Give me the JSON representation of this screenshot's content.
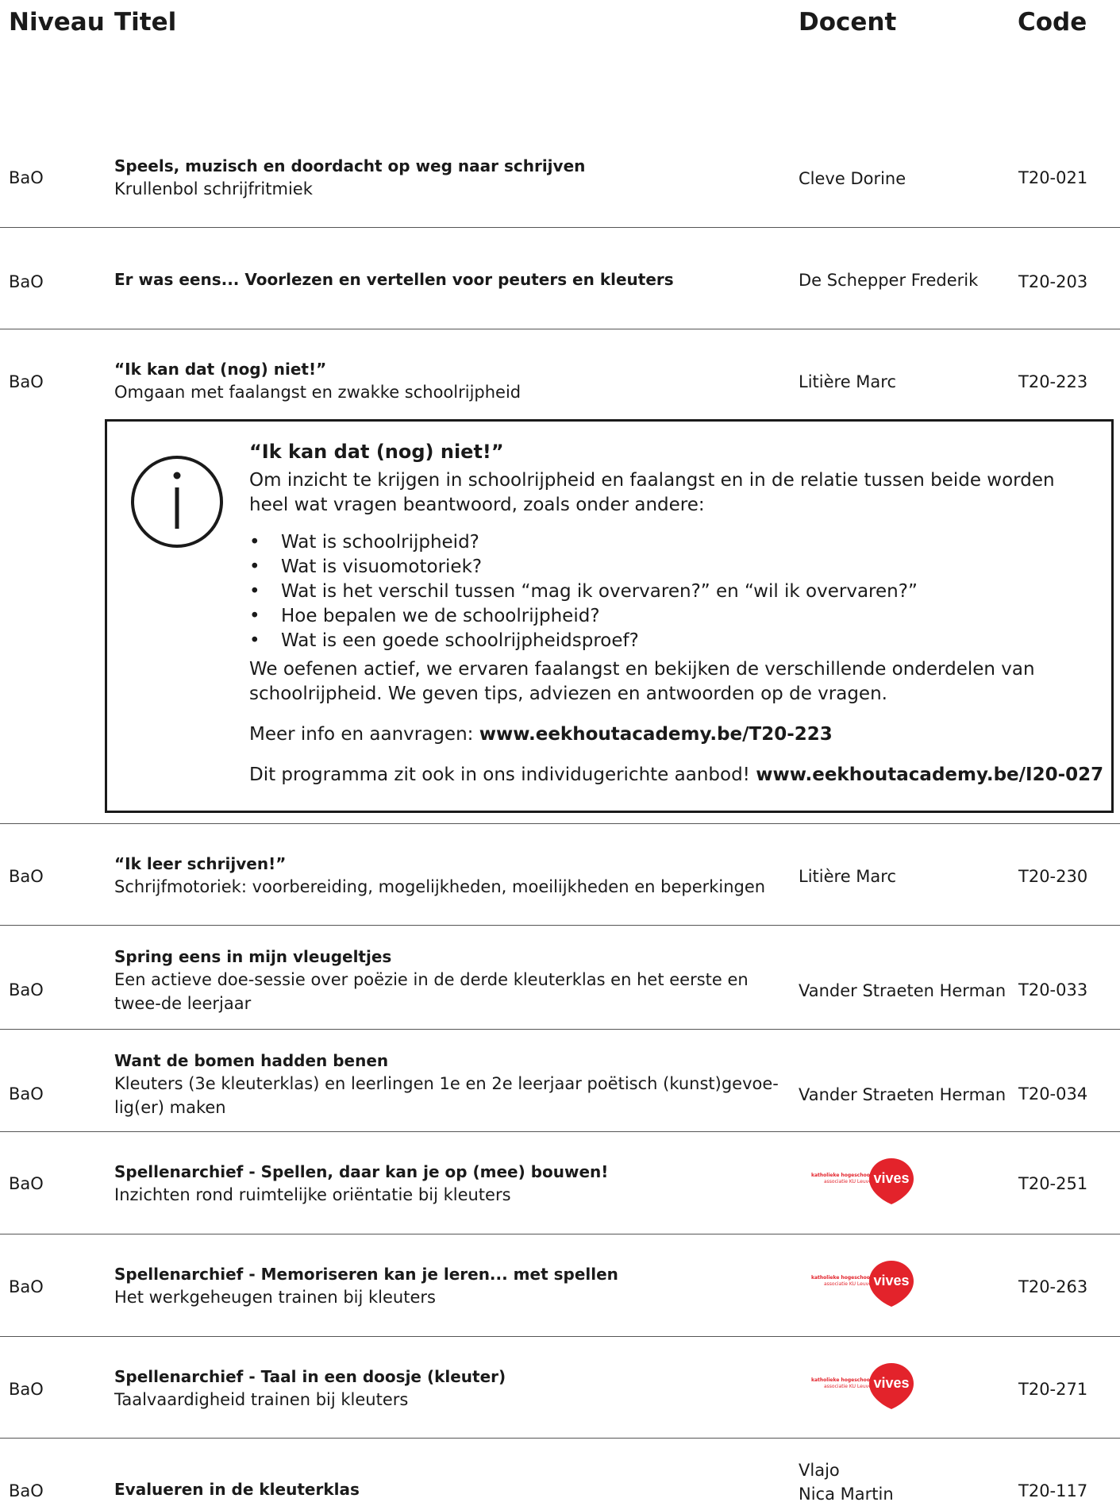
{
  "header": {
    "niveau": "Niveau",
    "titel": "Titel",
    "docent": "Docent",
    "code": "Code"
  },
  "rows": [
    {
      "niveau": "BaO",
      "title": "Speels, muzisch en doordacht op weg naar schrijven",
      "subtitle": "Krullenbol schrijfritmiek",
      "docent": "Cleve Dorine",
      "code": "T20-021"
    },
    {
      "niveau": "BaO",
      "title": "Er was eens... Voorlezen en vertellen voor peuters en kleuters",
      "subtitle": "",
      "docent": "De Schepper Frederik",
      "code": "T20-203"
    },
    {
      "niveau": "BaO",
      "title": "“Ik kan dat (nog) niet!”",
      "subtitle": "Omgaan met faalangst en zwakke schoolrijpheid",
      "docent": "Litière Marc",
      "code": "T20-223"
    },
    {
      "niveau": "BaO",
      "title": "“Ik leer schrijven!”",
      "subtitle": "Schrijfmotoriek: voorbereiding, mogelijkheden, moeilijkheden en beperkingen",
      "docent": "Litière Marc",
      "code": "T20-230"
    },
    {
      "niveau": "BaO",
      "title": "Spring eens in mijn vleugeltjes",
      "subtitle": "Een actieve doe-sessie over poëzie in de derde kleuterklas en het eerste en twee-de leerjaar",
      "docent": "Vander Straeten Herman",
      "code": "T20-033"
    },
    {
      "niveau": "BaO",
      "title": "Want de bomen hadden benen",
      "subtitle": "Kleuters (3e kleuterklas) en leerlingen 1e en 2e leerjaar poëtisch (kunst)gevoe-lig(er) maken",
      "docent": "Vander Straeten Herman",
      "code": "T20-034"
    },
    {
      "niveau": "BaO",
      "title": "Spellenarchief - Spellen, daar kan je op (mee) bouwen!",
      "subtitle": "Inzichten rond ruimtelijke oriëntatie bij kleuters",
      "docent": "",
      "code": "T20-251"
    },
    {
      "niveau": "BaO",
      "title": "Spellenarchief - Memoriseren kan je leren... met spellen",
      "subtitle": "Het werkgeheugen trainen bij kleuters",
      "docent": "",
      "code": "T20-263"
    },
    {
      "niveau": "BaO",
      "title": "Spellenarchief - Taal in een doosje (kleuter)",
      "subtitle": "Taalvaardigheid trainen bij kleuters",
      "docent": "",
      "code": "T20-271"
    },
    {
      "niveau": "BaO",
      "title": "Evalueren in de kleuterklas",
      "subtitle": "",
      "docent": "Vlajo",
      "docent2": "Nica Martin",
      "code": "T20-117"
    }
  ],
  "logo": {
    "word": "vives",
    "line1": "katholieke hogeschool",
    "line2": "associatie KU Leuven"
  },
  "infobox": {
    "title": "“Ik kan dat (nog) niet!”",
    "intro_line1": "Om inzicht te krijgen in schoolrijpheid en faalangst en in de relatie tussen beide worden",
    "intro_line2": "heel wat vragen beantwoord, zoals onder andere:",
    "bullets": [
      "Wat is schoolrijpheid?",
      "Wat is visuomotoriek?",
      "Wat is het verschil tussen “mag ik overvaren?” en “wil ik overvaren?”",
      "Hoe bepalen we de schoolrijpheid?",
      "Wat is een goede schoolrijpheidsproef?"
    ],
    "outro_line1": "We oefenen actief, we ervaren faalangst en bekijken de verschillende onderdelen van",
    "outro_line2": "schoolrijpheid. We geven tips, adviezen en antwoorden op de vragen.",
    "more_info_label": "Meer info en aanvragen: ",
    "more_info_link": "www.eekhoutacademy.be/T20-223",
    "program_label": "Dit programma zit ook in ons individugerichte aanbod! ",
    "program_link": "www.eekhoutacademy.be/I20-027"
  }
}
